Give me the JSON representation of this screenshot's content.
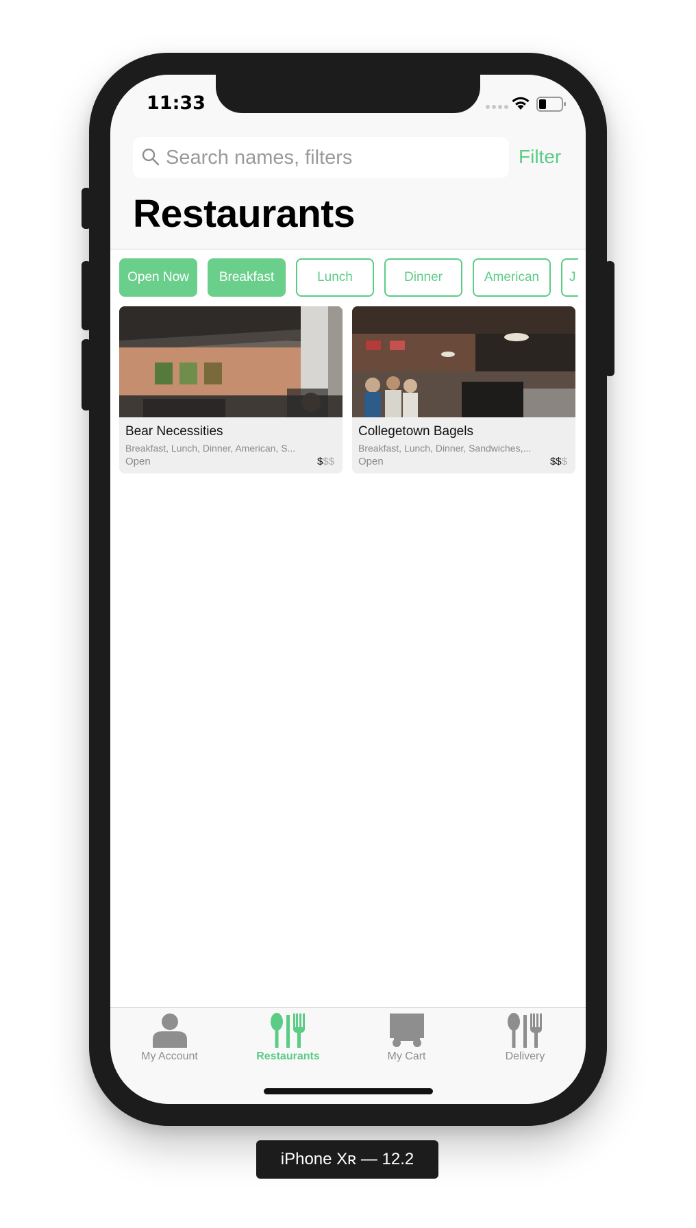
{
  "status_bar": {
    "time": "11:33"
  },
  "search": {
    "placeholder": "Search names, filters",
    "filter_label": "Filter"
  },
  "header": {
    "title": "Restaurants"
  },
  "filter_chips": [
    {
      "label": "Open Now",
      "active": true
    },
    {
      "label": "Breakfast",
      "active": true
    },
    {
      "label": "Lunch",
      "active": false
    },
    {
      "label": "Dinner",
      "active": false
    },
    {
      "label": "American",
      "active": false
    },
    {
      "label": "J",
      "active": false
    }
  ],
  "restaurants": [
    {
      "name": "Bear Necessities",
      "tags": "Breakfast, Lunch, Dinner, American, S...",
      "status": "Open",
      "price_active": "$",
      "price_inactive": "$$"
    },
    {
      "name": "Collegetown Bagels",
      "tags": "Breakfast, Lunch, Dinner, Sandwiches,...",
      "status": "Open",
      "price_active": "$$",
      "price_inactive": "$"
    }
  ],
  "tabbar": {
    "items": [
      {
        "label": "My Account",
        "icon": "person-icon",
        "active": false
      },
      {
        "label": "Restaurants",
        "icon": "utensils-icon",
        "active": true
      },
      {
        "label": "My Cart",
        "icon": "cart-icon",
        "active": false
      },
      {
        "label": "Delivery",
        "icon": "utensils-icon",
        "active": false
      }
    ]
  },
  "device_label": "iPhone Xʀ — 12.2",
  "colors": {
    "accent": "#5ccb86",
    "chip_active_bg": "#6bcf8c",
    "tab_inactive": "#8e8e8e"
  }
}
